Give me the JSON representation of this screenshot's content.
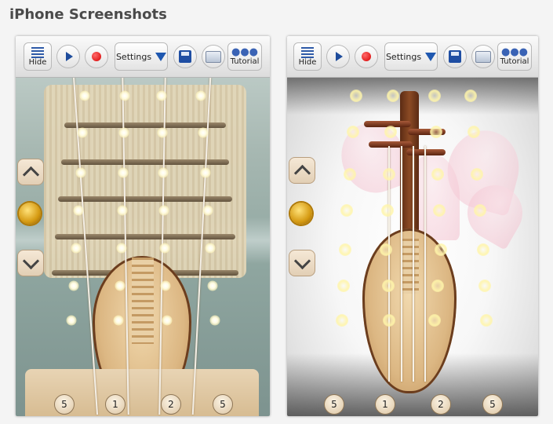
{
  "page": {
    "title": "iPhone Screenshots"
  },
  "toolbar": {
    "hide_label": "Hide",
    "settings_label": "Settings",
    "tutorial_label": "Tutorial"
  },
  "screenshot1": {
    "bottom_numbers": [
      "5",
      "1",
      "2",
      "5"
    ]
  },
  "screenshot2": {
    "bottom_numbers": [
      "5",
      "1",
      "2",
      "5"
    ]
  },
  "colors": {
    "accent": "#1f58b0",
    "record": "#d60000",
    "wood": "#dcb783"
  },
  "icons": [
    "hide-icon",
    "play-icon",
    "record-icon",
    "dropdown-triangle-icon",
    "save-icon",
    "folder-icon",
    "tutorial-people-icon",
    "chevron-up-icon",
    "chevron-down-icon",
    "lion-knocker-icon"
  ]
}
